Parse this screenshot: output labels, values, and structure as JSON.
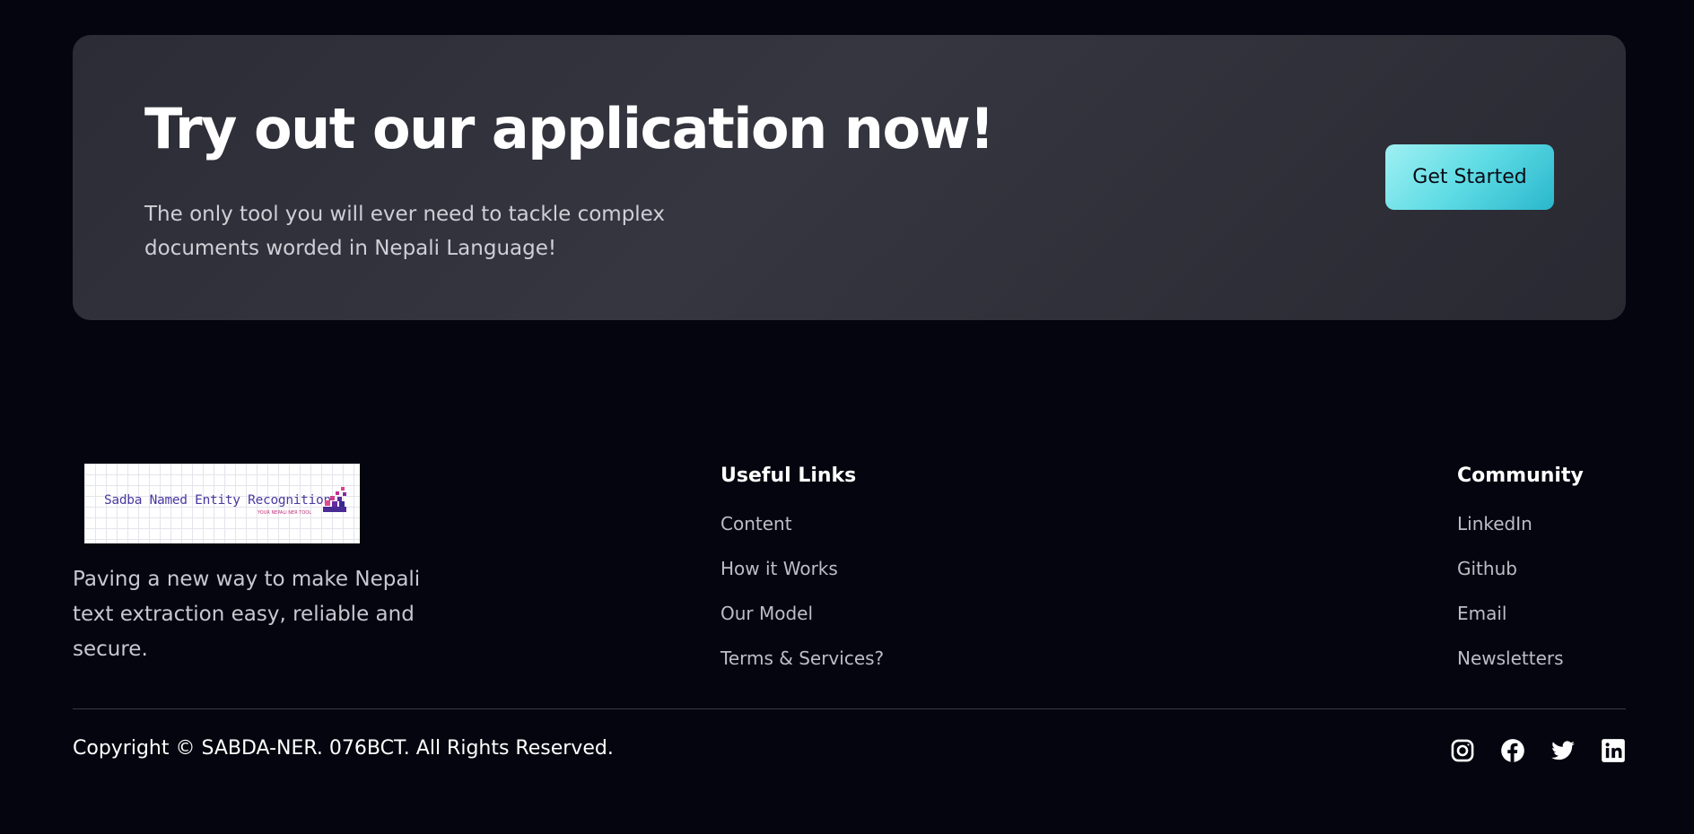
{
  "cta": {
    "title": "Try out our application now!",
    "description": "The only tool you will ever need to tackle complex documents worded in Nepali Language!",
    "button_label": "Get Started"
  },
  "brand": {
    "logo_text": "Sadba Named Entity Recognition",
    "logo_subtext": "YOUR NEPALI NER TOOL",
    "tagline": "Paving a new way to make Nepali text extraction easy, reliable and secure."
  },
  "useful_links": {
    "title": "Useful Links",
    "items": [
      "Content",
      "How it Works",
      "Our Model",
      "Terms & Services?"
    ]
  },
  "community": {
    "title": "Community",
    "items": [
      "LinkedIn",
      "Github",
      "Email",
      "Newsletters"
    ]
  },
  "footer": {
    "copyright": "Copyright © SABDA-NER. 076BCT. All Rights Reserved.",
    "social_icons": [
      "instagram-icon",
      "facebook-icon",
      "twitter-icon",
      "linkedin-icon"
    ]
  },
  "colors": {
    "background": "#04050f",
    "card": "#32323c",
    "accent": "#5ddbe4"
  }
}
